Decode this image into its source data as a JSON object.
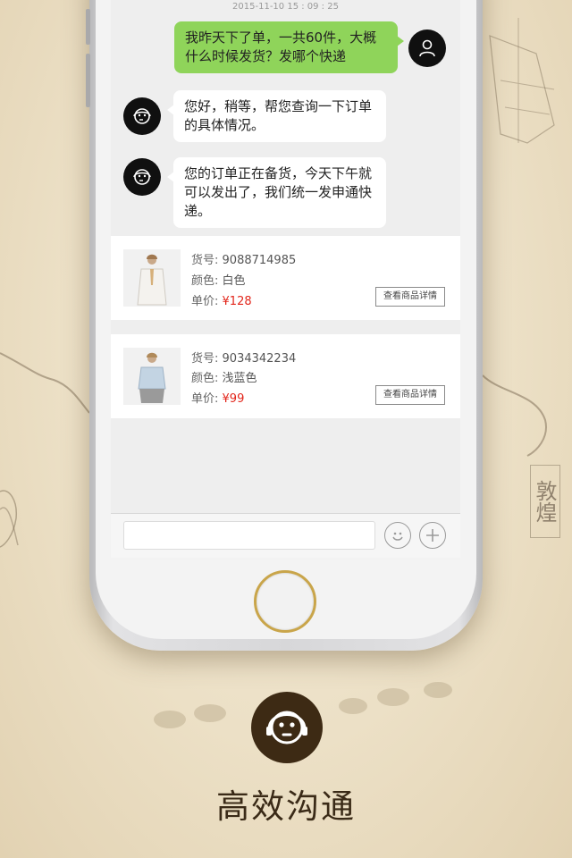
{
  "timestamp": "2015-11-10    15 : 09 : 25",
  "messages": [
    {
      "from": "user",
      "text": "我昨天下了单，一共60件，大概什么时候发货？发哪个快递"
    },
    {
      "from": "agent",
      "text": "您好，稍等，帮您查询一下订单的具体情况。"
    },
    {
      "from": "agent",
      "text": "您的订单正在备货，今天下午就可以发出了，我们统一发申通快递。"
    }
  ],
  "products": [
    {
      "item_no_label": "货号:",
      "item_no": "9088714985",
      "color_label": "颜色:",
      "color": "白色",
      "price_label": "单价:",
      "price": "¥128",
      "detail_button": "查看商品详情"
    },
    {
      "item_no_label": "货号:",
      "item_no": "9034342234",
      "color_label": "颜色:",
      "color": "浅蓝色",
      "price_label": "单价:",
      "price": "¥99",
      "detail_button": "查看商品详情"
    }
  ],
  "input_bar": {
    "placeholder": "",
    "emoji_icon": "smiley-icon",
    "add_icon": "plus-icon"
  },
  "feature": {
    "title": "高效沟通",
    "icon": "customer-service-icon"
  },
  "background_text": {
    "seal": "敦煌"
  },
  "colors": {
    "user_bubble": "#8fd45a",
    "agent_bubble": "#ffffff",
    "price": "#e2261b",
    "feature_icon_bg": "#3d2a14",
    "home_ring": "#c9a54a"
  }
}
